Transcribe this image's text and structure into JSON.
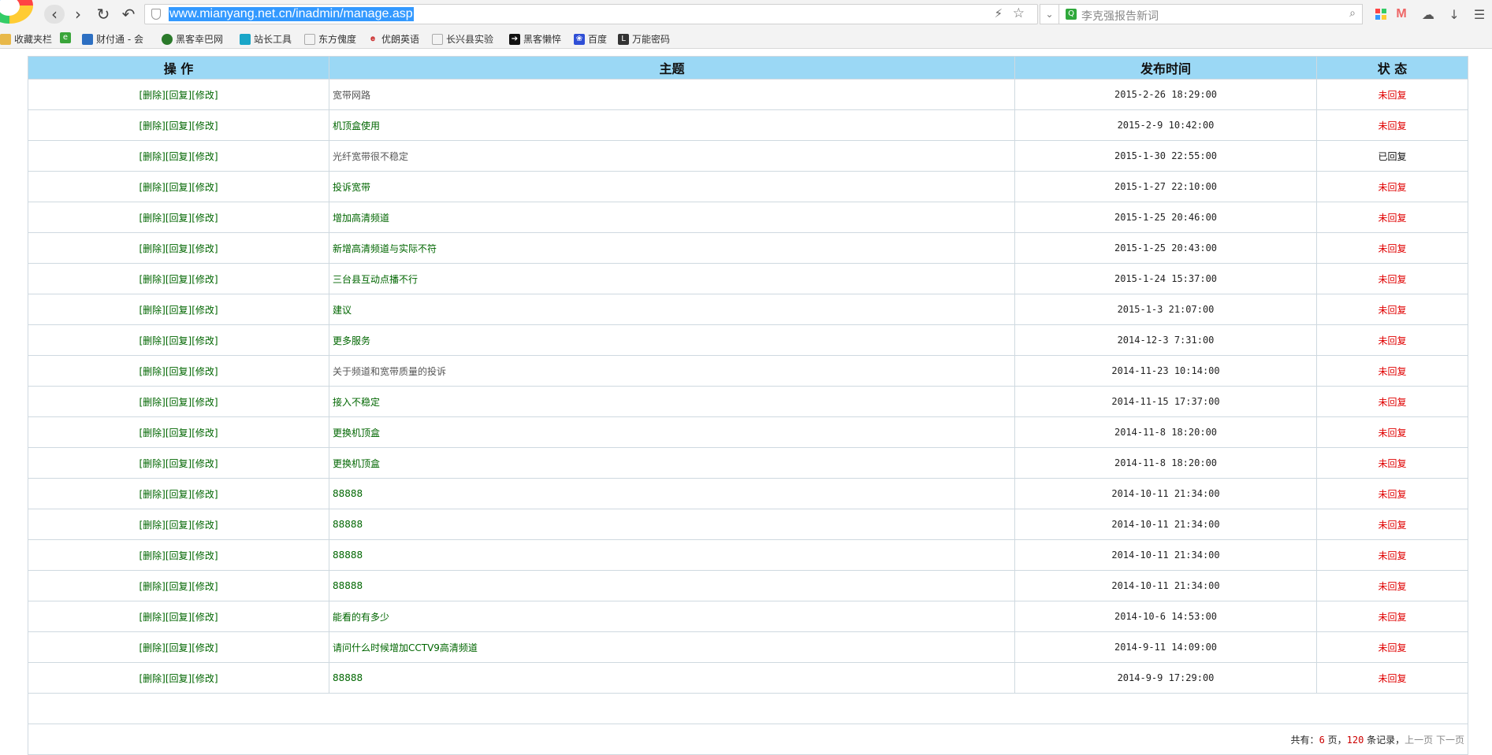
{
  "browser": {
    "url": "www.mianyang.net.cn/inadmin/manage.asp",
    "search_placeholder": "李克强报告新词",
    "bookmarks": [
      {
        "label": "收藏夹栏"
      },
      {
        "label": ""
      },
      {
        "label": "财付通 - 会"
      },
      {
        "label": "黑客幸巴网"
      },
      {
        "label": "站长工具"
      },
      {
        "label": "东方傀度"
      },
      {
        "label": "优朗英语"
      },
      {
        "label": "长兴县实验"
      },
      {
        "label": "黑客懒悴"
      },
      {
        "label": "百度"
      },
      {
        "label": "万能密码"
      }
    ]
  },
  "table": {
    "headers": {
      "op": "操 作",
      "title": "主题",
      "time": "发布时间",
      "status": "状 态"
    },
    "op_labels": {
      "delete": "[删除]",
      "reply": "[回复]",
      "edit": "[修改]"
    },
    "rows": [
      {
        "title": "宽带网路",
        "time": "2015-2-26 18:29:00",
        "status": "未回复"
      },
      {
        "title": "机顶盒使用",
        "time": "2015-2-9 10:42:00",
        "status": "未回复"
      },
      {
        "title": "光纤宽带很不稳定",
        "time": "2015-1-30 22:55:00",
        "status": "已回复"
      },
      {
        "title": "投诉宽带",
        "time": "2015-1-27 22:10:00",
        "status": "未回复"
      },
      {
        "title": "增加高清频道",
        "time": "2015-1-25 20:46:00",
        "status": "未回复"
      },
      {
        "title": "新增高清频道与实际不符",
        "time": "2015-1-25 20:43:00",
        "status": "未回复"
      },
      {
        "title": "三台县互动点播不行",
        "time": "2015-1-24 15:37:00",
        "status": "未回复"
      },
      {
        "title": "建议",
        "time": "2015-1-3 21:07:00",
        "status": "未回复"
      },
      {
        "title": "更多服务",
        "time": "2014-12-3 7:31:00",
        "status": "未回复"
      },
      {
        "title": "关于频道和宽带质量的投诉",
        "time": "2014-11-23 10:14:00",
        "status": "未回复"
      },
      {
        "title": "接入不稳定",
        "time": "2014-11-15 17:37:00",
        "status": "未回复"
      },
      {
        "title": "更换机顶盒",
        "time": "2014-11-8 18:20:00",
        "status": "未回复"
      },
      {
        "title": "更换机顶盒",
        "time": "2014-11-8 18:20:00",
        "status": "未回复"
      },
      {
        "title": "88888",
        "time": "2014-10-11 21:34:00",
        "status": "未回复"
      },
      {
        "title": "88888",
        "time": "2014-10-11 21:34:00",
        "status": "未回复"
      },
      {
        "title": "88888",
        "time": "2014-10-11 21:34:00",
        "status": "未回复"
      },
      {
        "title": "88888",
        "time": "2014-10-11 21:34:00",
        "status": "未回复"
      },
      {
        "title": "能看的有多少",
        "time": "2014-10-6 14:53:00",
        "status": "未回复"
      },
      {
        "title": "请问什么时候增加CCTV9高清频道",
        "time": "2014-9-11 14:09:00",
        "status": "未回复"
      },
      {
        "title": "88888",
        "time": "2014-9-9 17:29:00",
        "status": "未回复"
      }
    ]
  },
  "pager": {
    "prefix": "共有：",
    "pages": "6",
    "pages_unit": " 页，",
    "records": "120",
    "records_unit": " 条记录，",
    "prev": "上一页",
    "next": "下一页"
  },
  "colors": {
    "header_bg": "#9bd8f5",
    "link_green": "#006600",
    "status_red": "#e00000"
  }
}
